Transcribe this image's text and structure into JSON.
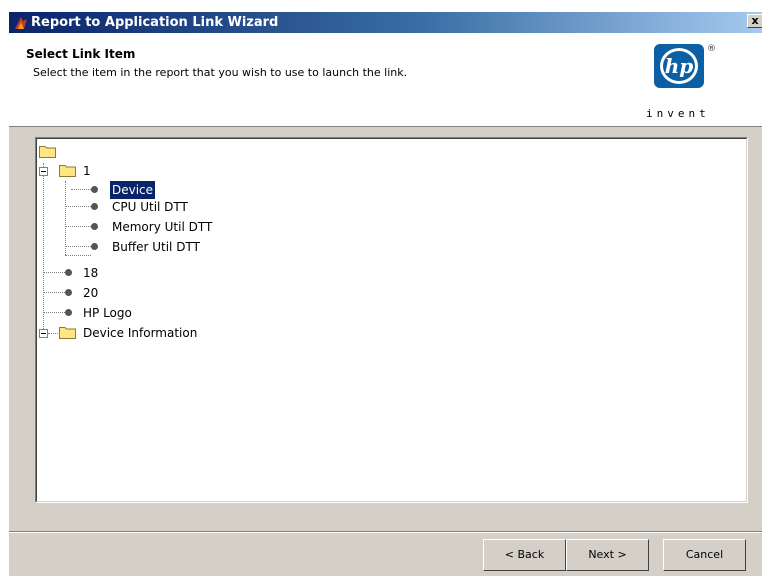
{
  "window": {
    "title": "Report to Application Link Wizard",
    "close_label": "x"
  },
  "header": {
    "title": "Select Link Item",
    "description": "Select the item in the report that you wish to use to launch the link.",
    "logo_text": "hp",
    "logo_mark": "®",
    "logo_tagline": "invent"
  },
  "tree": {
    "selected": "Device",
    "items": [
      {
        "label": "",
        "type": "folder",
        "expanded": true
      },
      {
        "label": "1",
        "type": "folder",
        "expanded": true
      },
      {
        "label": "Device",
        "type": "leaf",
        "selected": true
      },
      {
        "label": "CPU Util DTT",
        "type": "leaf"
      },
      {
        "label": "Memory Util DTT",
        "type": "leaf"
      },
      {
        "label": "Buffer Util DTT",
        "type": "leaf"
      },
      {
        "label": "18",
        "type": "leaf"
      },
      {
        "label": "20",
        "type": "leaf"
      },
      {
        "label": "HP Logo",
        "type": "leaf"
      },
      {
        "label": "Device Information",
        "type": "folder",
        "expanded": true
      }
    ]
  },
  "buttons": {
    "back": "< Back",
    "next": "Next >",
    "cancel": "Cancel"
  },
  "colors": {
    "selection": "#0a246a",
    "dialog": "#d4d0c8",
    "logo_blue": "#0b5fa5"
  }
}
